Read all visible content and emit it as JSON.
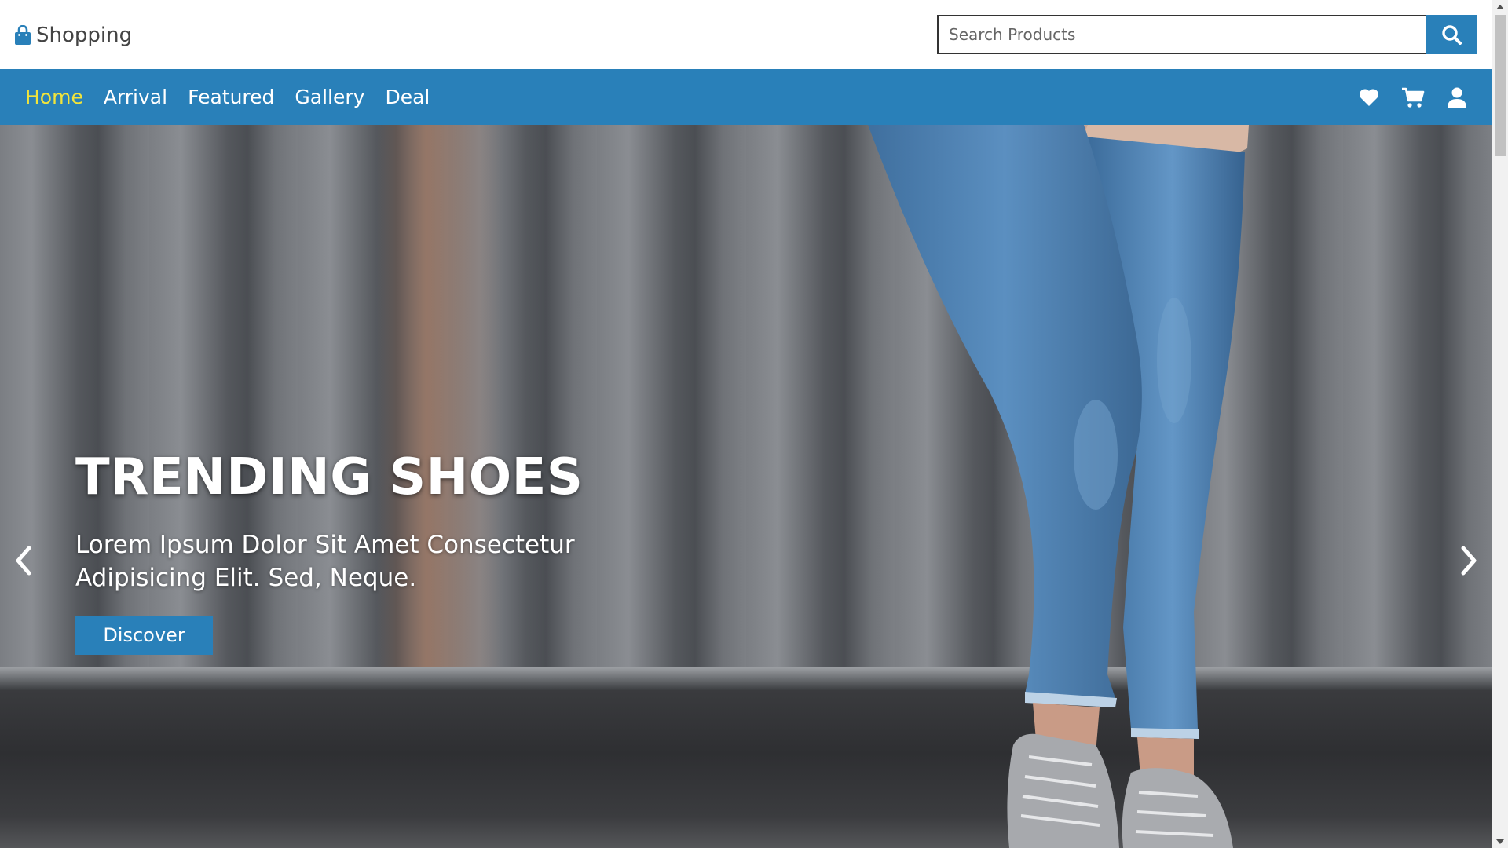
{
  "brand": {
    "name": "Shopping",
    "icon": "shopping-bag-icon"
  },
  "search": {
    "placeholder": "Search Products",
    "value": "",
    "button_icon": "search-icon"
  },
  "nav": {
    "links": [
      {
        "label": "Home",
        "active": true
      },
      {
        "label": "Arrival",
        "active": false
      },
      {
        "label": "Featured",
        "active": false
      },
      {
        "label": "Gallery",
        "active": false
      },
      {
        "label": "Deal",
        "active": false
      }
    ],
    "icons": [
      "heart-icon",
      "cart-icon",
      "user-icon"
    ]
  },
  "hero": {
    "title": "TRENDING SHOES",
    "description": "Lorem Ipsum Dolor Sit Amet Consectetur Adipisicing Elit. Sed, Neque.",
    "button_label": "Discover",
    "prev_icon": "chevron-left-icon",
    "next_icon": "chevron-right-icon"
  },
  "colors": {
    "accent": "#2980b9",
    "active_link": "#f1e43b",
    "text_on_accent": "#ffffff"
  }
}
